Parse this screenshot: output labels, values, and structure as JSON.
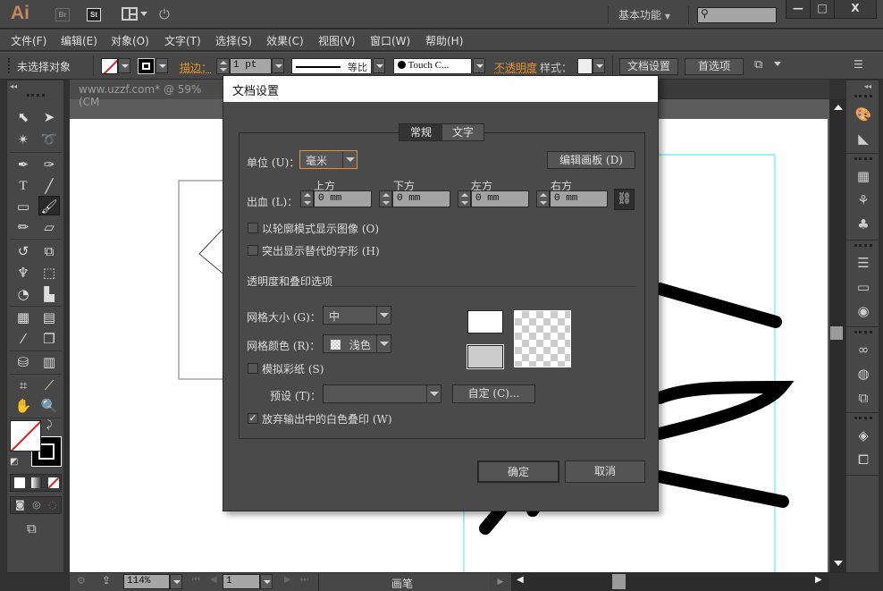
{
  "app": {
    "logo": "Ai",
    "bridge_label": "Br",
    "stock_label": "St",
    "workspace": "基本功能",
    "search_placeholder": "",
    "window_buttons": {
      "minimize": "—",
      "maximize": "□",
      "close": "X"
    }
  },
  "menu": [
    "文件(F)",
    "编辑(E)",
    "对象(O)",
    "文字(T)",
    "选择(S)",
    "效果(C)",
    "视图(V)",
    "窗口(W)",
    "帮助(H)"
  ],
  "control": {
    "selection_status": "未选择对象",
    "stroke_label": "描边：",
    "stroke_weight": "1 pt",
    "stroke_profile": "等比",
    "brush": "Touch C...",
    "opacity_label": "不透明度",
    "style_label": "样式：",
    "doc_setup_button": "文档设置",
    "prefs_button": "首选项"
  },
  "document": {
    "tab_title": "www.uzzf.com* @ 59% (CM"
  },
  "dialog": {
    "title": "文档设置",
    "tabs": [
      {
        "label": "常规",
        "active": true
      },
      {
        "label": "文字",
        "active": false
      }
    ],
    "unit_label": "单位 (U)：",
    "unit_value": "毫米",
    "edit_artboards_button": "编辑画板 (D)",
    "bleed_label": "出血 (L)：",
    "bleed": [
      {
        "label": "上方",
        "value": "0 mm"
      },
      {
        "label": "下方",
        "value": "0 mm"
      },
      {
        "label": "左方",
        "value": "0 mm"
      },
      {
        "label": "右方",
        "value": "0 mm"
      }
    ],
    "show_images_outline": {
      "label": "以轮廓模式显示图像 (O)",
      "checked": false
    },
    "highlight_glyphs": {
      "label": "突出显示替代的字形 (H)",
      "checked": false
    },
    "transparency_section": "透明度和叠印选项",
    "grid_size_label": "网格大小 (G)：",
    "grid_size_value": "中",
    "grid_color_label": "网格颜色 (R)：",
    "grid_color_value": "浅色",
    "simulate_paper": {
      "label": "模拟彩纸 (S)",
      "checked": false
    },
    "preset_label": "预设 (T)：",
    "preset_value": "",
    "custom_button": "自定 (C)...",
    "discard_white_overprint": {
      "label": "放弃输出中的白色叠印 (W)",
      "checked": true
    },
    "ok_button": "确定",
    "cancel_button": "取消"
  },
  "status": {
    "zoom": "114%",
    "artboard_number": "1",
    "tool_name": "画笔"
  },
  "colors": {
    "accent_orange": "#e8922f",
    "guide_cyan": "#3ee8f0",
    "panel_bg": "#474747"
  }
}
